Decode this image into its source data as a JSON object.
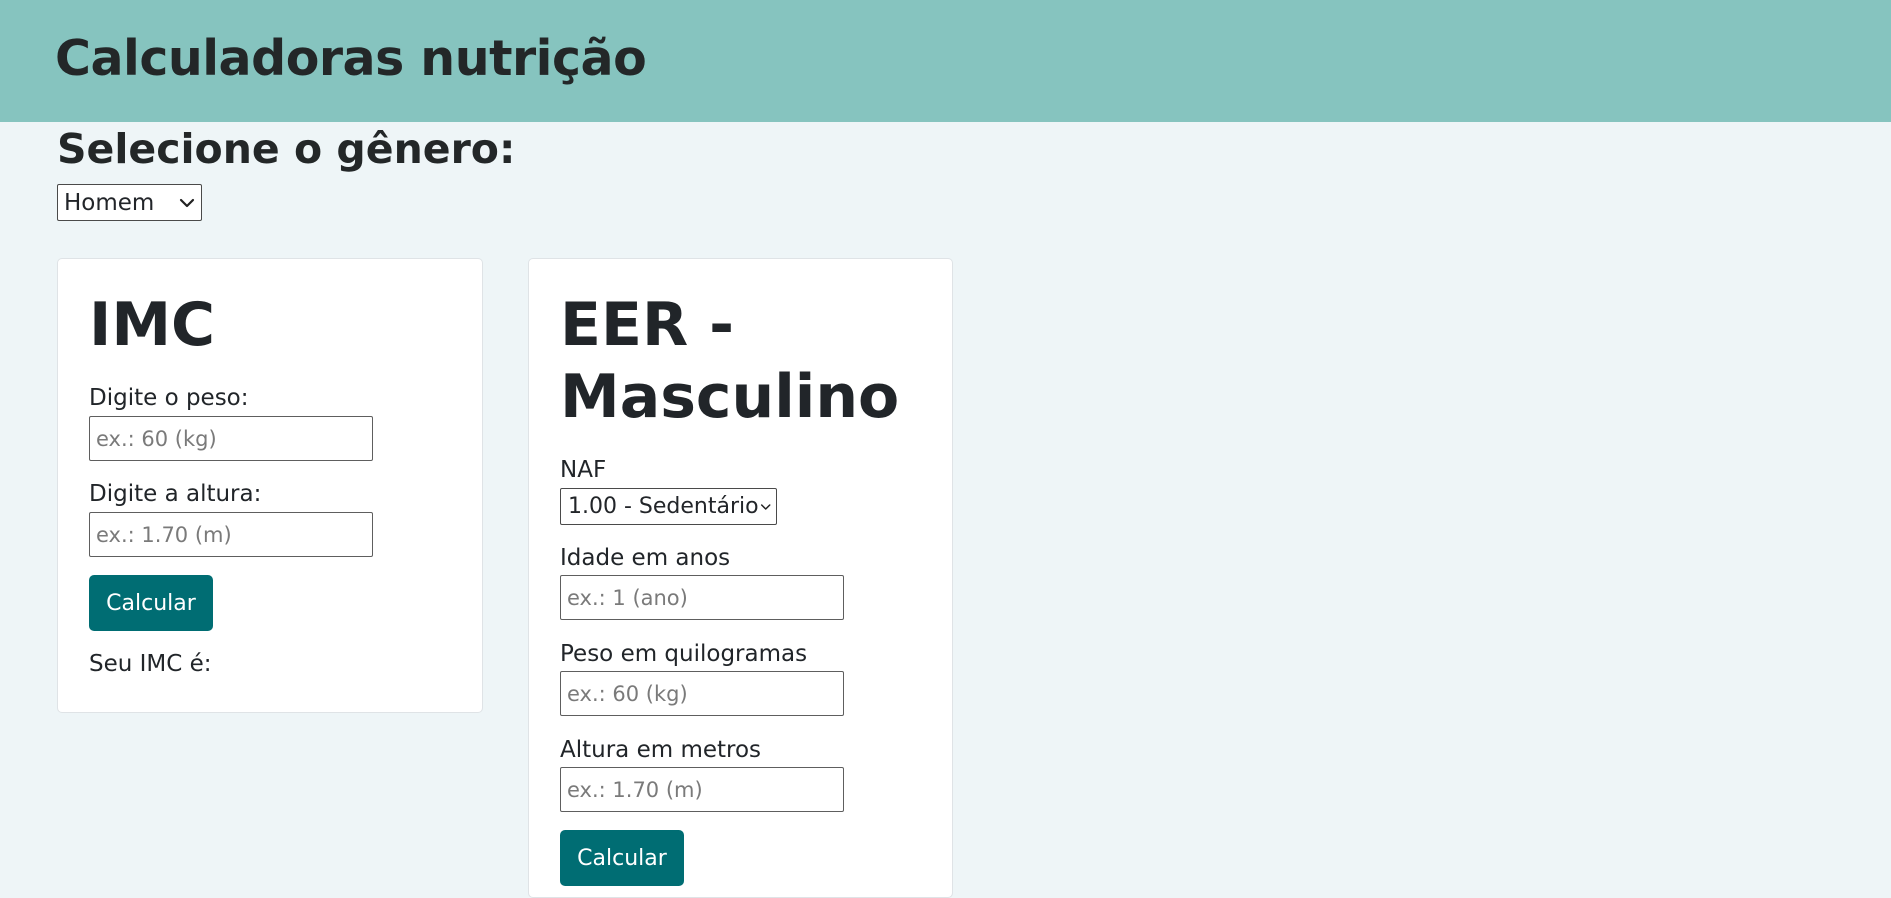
{
  "header": {
    "title": "Calculadoras nutrição"
  },
  "gender": {
    "label": "Selecione o gênero:",
    "selected": "Homem"
  },
  "imc_card": {
    "title": "IMC",
    "weight_label": "Digite o peso:",
    "weight_placeholder": "ex.: 60 (kg)",
    "height_label": "Digite a altura:",
    "height_placeholder": "ex.: 1.70 (m)",
    "button_label": "Calcular",
    "result_label": "Seu IMC é:"
  },
  "eer_card": {
    "title_line1": "EER -",
    "title_line2": "Masculino",
    "naf_label": "NAF",
    "naf_selected": "1.00 - Sedentário",
    "age_label": "Idade em anos",
    "age_placeholder": "ex.: 1 (ano)",
    "weight_label": "Peso em quilogramas",
    "weight_placeholder": "ex.: 60 (kg)",
    "height_label": "Altura em metros",
    "height_placeholder": "ex.: 1.70 (m)",
    "button_label": "Calcular"
  },
  "icons": {
    "select_arrow": "chevron-down-icon"
  },
  "colors": {
    "header_bg": "#86c4bf",
    "page_bg": "#eef5f7",
    "button_bg": "#006d73"
  }
}
